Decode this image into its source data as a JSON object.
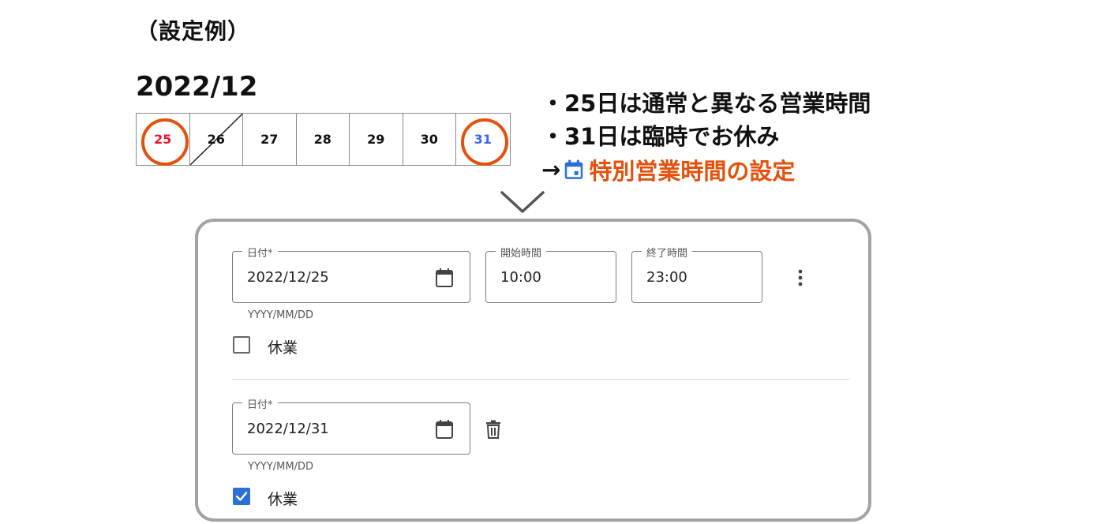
{
  "header": {
    "example_title": "（設定例）",
    "month": "2022/12"
  },
  "calendar": {
    "days": [
      {
        "label": "25",
        "state": "circled-red"
      },
      {
        "label": "26",
        "state": "struck"
      },
      {
        "label": "27",
        "state": "normal"
      },
      {
        "label": "28",
        "state": "normal"
      },
      {
        "label": "29",
        "state": "normal"
      },
      {
        "label": "30",
        "state": "normal"
      },
      {
        "label": "31",
        "state": "circled-blue"
      }
    ],
    "circle_color": "#e3510c"
  },
  "notes": {
    "line1": "・25日は通常と異なる営業時間",
    "line2": "・31日は臨時でお休み",
    "arrow": "→",
    "line3_icon": "calendar-icon",
    "line3": "特別営業時間の設定"
  },
  "form": {
    "entry1": {
      "date_label": "日付*",
      "date_value": "2022/12/25",
      "date_helper": "YYYY/MM/DD",
      "start_label": "開始時間",
      "start_value": "10:00",
      "end_label": "終了時間",
      "end_value": "23:00",
      "closed_label": "休業",
      "closed_checked": false
    },
    "entry2": {
      "date_label": "日付*",
      "date_value": "2022/12/31",
      "date_helper": "YYYY/MM/DD",
      "closed_label": "休業",
      "closed_checked": true
    }
  },
  "colors": {
    "accent_orange": "#e3510c",
    "accent_blue": "#2b6fd8",
    "red_text": "#e5162a"
  }
}
